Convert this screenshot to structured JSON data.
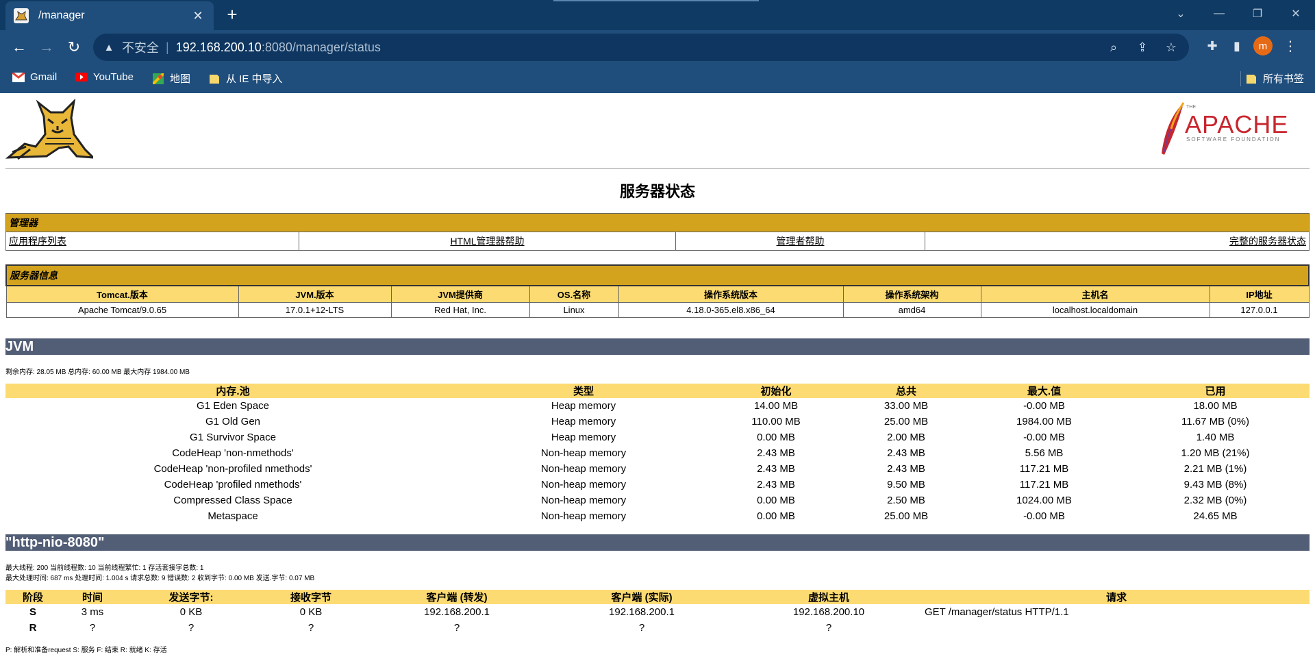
{
  "browser": {
    "tab_title": "/manager",
    "tab_close": "✕",
    "new_tab": "+",
    "insecure_label": "不安全",
    "url_host": "192.168.200.10",
    "url_rest": ":8080/manager/status",
    "profile_initial": "m",
    "bookmarks": [
      {
        "label": "Gmail",
        "icon": "gmail-icon"
      },
      {
        "label": "YouTube",
        "icon": "youtube-icon"
      },
      {
        "label": "地图",
        "icon": "maps-icon"
      },
      {
        "label": "从 IE 中导入",
        "icon": "folder-icon"
      }
    ],
    "all_bookmarks": "所有书签"
  },
  "page": {
    "title": "服务器状态",
    "manager": {
      "header": "管理器",
      "links": [
        "应用程序列表",
        "HTML管理器帮助",
        "管理者帮助",
        "完整的服务器状态"
      ]
    },
    "server_info": {
      "header": "服务器信息",
      "columns": [
        "Tomcat.版本",
        "JVM.版本",
        "JVM提供商",
        "OS.名称",
        "操作系统版本",
        "操作系统架构",
        "主机名",
        "IP地址"
      ],
      "values": [
        "Apache Tomcat/9.0.65",
        "17.0.1+12-LTS",
        "Red Hat, Inc.",
        "Linux",
        "4.18.0-365.el8.x86_64",
        "amd64",
        "localhost.localdomain",
        "127.0.0.1"
      ]
    },
    "jvm": {
      "title": "JVM",
      "summary": "剩余内存:  28.05 MB 总内存:  60.00 MB 最大内存 1984.00 MB",
      "columns": [
        "内存.池",
        "类型",
        "初始化",
        "总共",
        "最大.值",
        "已用"
      ],
      "rows": [
        [
          "G1 Eden Space",
          "Heap memory",
          "14.00 MB",
          "33.00 MB",
          "-0.00 MB",
          "18.00 MB"
        ],
        [
          "G1 Old Gen",
          "Heap memory",
          "110.00 MB",
          "25.00 MB",
          "1984.00 MB",
          "11.67 MB (0%)"
        ],
        [
          "G1 Survivor Space",
          "Heap memory",
          "0.00 MB",
          "2.00 MB",
          "-0.00 MB",
          "1.40 MB"
        ],
        [
          "CodeHeap 'non-nmethods'",
          "Non-heap memory",
          "2.43 MB",
          "2.43 MB",
          "5.56 MB",
          "1.20 MB (21%)"
        ],
        [
          "CodeHeap 'non-profiled nmethods'",
          "Non-heap memory",
          "2.43 MB",
          "2.43 MB",
          "117.21 MB",
          "2.21 MB (1%)"
        ],
        [
          "CodeHeap 'profiled nmethods'",
          "Non-heap memory",
          "2.43 MB",
          "9.50 MB",
          "117.21 MB",
          "9.43 MB (8%)"
        ],
        [
          "Compressed Class Space",
          "Non-heap memory",
          "0.00 MB",
          "2.50 MB",
          "1024.00 MB",
          "2.32 MB (0%)"
        ],
        [
          "Metaspace",
          "Non-heap memory",
          "0.00 MB",
          "25.00 MB",
          "-0.00 MB",
          "24.65 MB"
        ]
      ]
    },
    "connector": {
      "title": "\"http-nio-8080\"",
      "line1": "最大线程:  200 当前线程数:  10 当前线程繁忙:  1 存活套接字总数:  1",
      "line2": "最大处理时间:  687 ms 处理时间:  1.004 s 请求总数:  9 错误数:  2 收到字节:  0.00 MB 发送.字节: 0.07 MB",
      "columns": [
        "阶段",
        "时间",
        "发送字节:",
        "接收字节",
        "客户端 (转发)",
        "客户端 (实际)",
        "虚拟主机",
        "请求"
      ],
      "rows": [
        [
          "S",
          "3 ms",
          "0 KB",
          "0 KB",
          "192.168.200.1",
          "192.168.200.1",
          "192.168.200.10",
          "GET /manager/status HTTP/1.1"
        ],
        [
          "R",
          "?",
          "?",
          "?",
          "?",
          "?",
          "?",
          ""
        ]
      ],
      "legend": "P:  解析和准备request S:  服务 F:  结束 R:  就绪 K:  存活"
    }
  }
}
